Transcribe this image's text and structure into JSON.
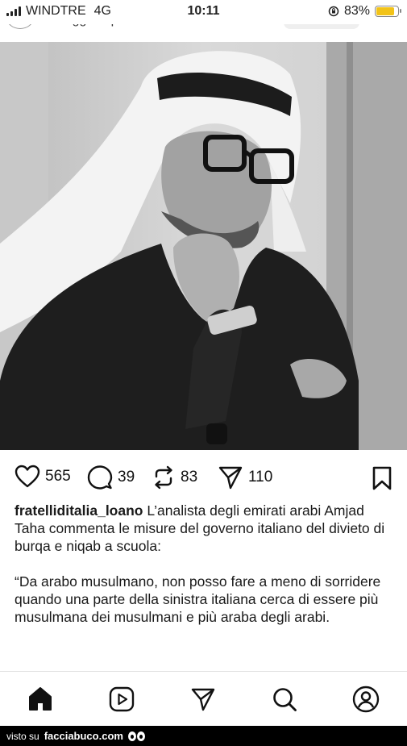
{
  "status_bar": {
    "carrier": "WINDTRE",
    "network": "4G",
    "time": "10:11",
    "battery_percent": "83%",
    "battery_level": 0.83,
    "battery_color": "#f2c318"
  },
  "header": {
    "suggested_label": "Suggeriti per te"
  },
  "post": {
    "image_description_icon": "photo",
    "likes": "565",
    "comments": "39",
    "reposts": "83",
    "shares": "110",
    "icons": {
      "like": "heart-icon",
      "comment": "comment-icon",
      "repost": "repost-icon",
      "share": "send-icon",
      "save": "bookmark-icon"
    },
    "caption": {
      "username": "fratelliditalia_loano",
      "text": " L’analista degli emirati arabi Amjad Taha commenta le misure del governo italiano del divieto di burqa e niqab a scuola:",
      "quote": "“Da arabo musulmano, non posso fare a meno di sorridere quando una parte della sinistra italiana cerca di essere più musulmana dei musulmani e più araba degli arabi."
    }
  },
  "bottom_nav": {
    "items": [
      "home-icon",
      "reels-icon",
      "send-icon",
      "search-icon",
      "profile-icon"
    ]
  },
  "watermark": {
    "prefix": "visto su",
    "site": "facciabuco.com"
  }
}
